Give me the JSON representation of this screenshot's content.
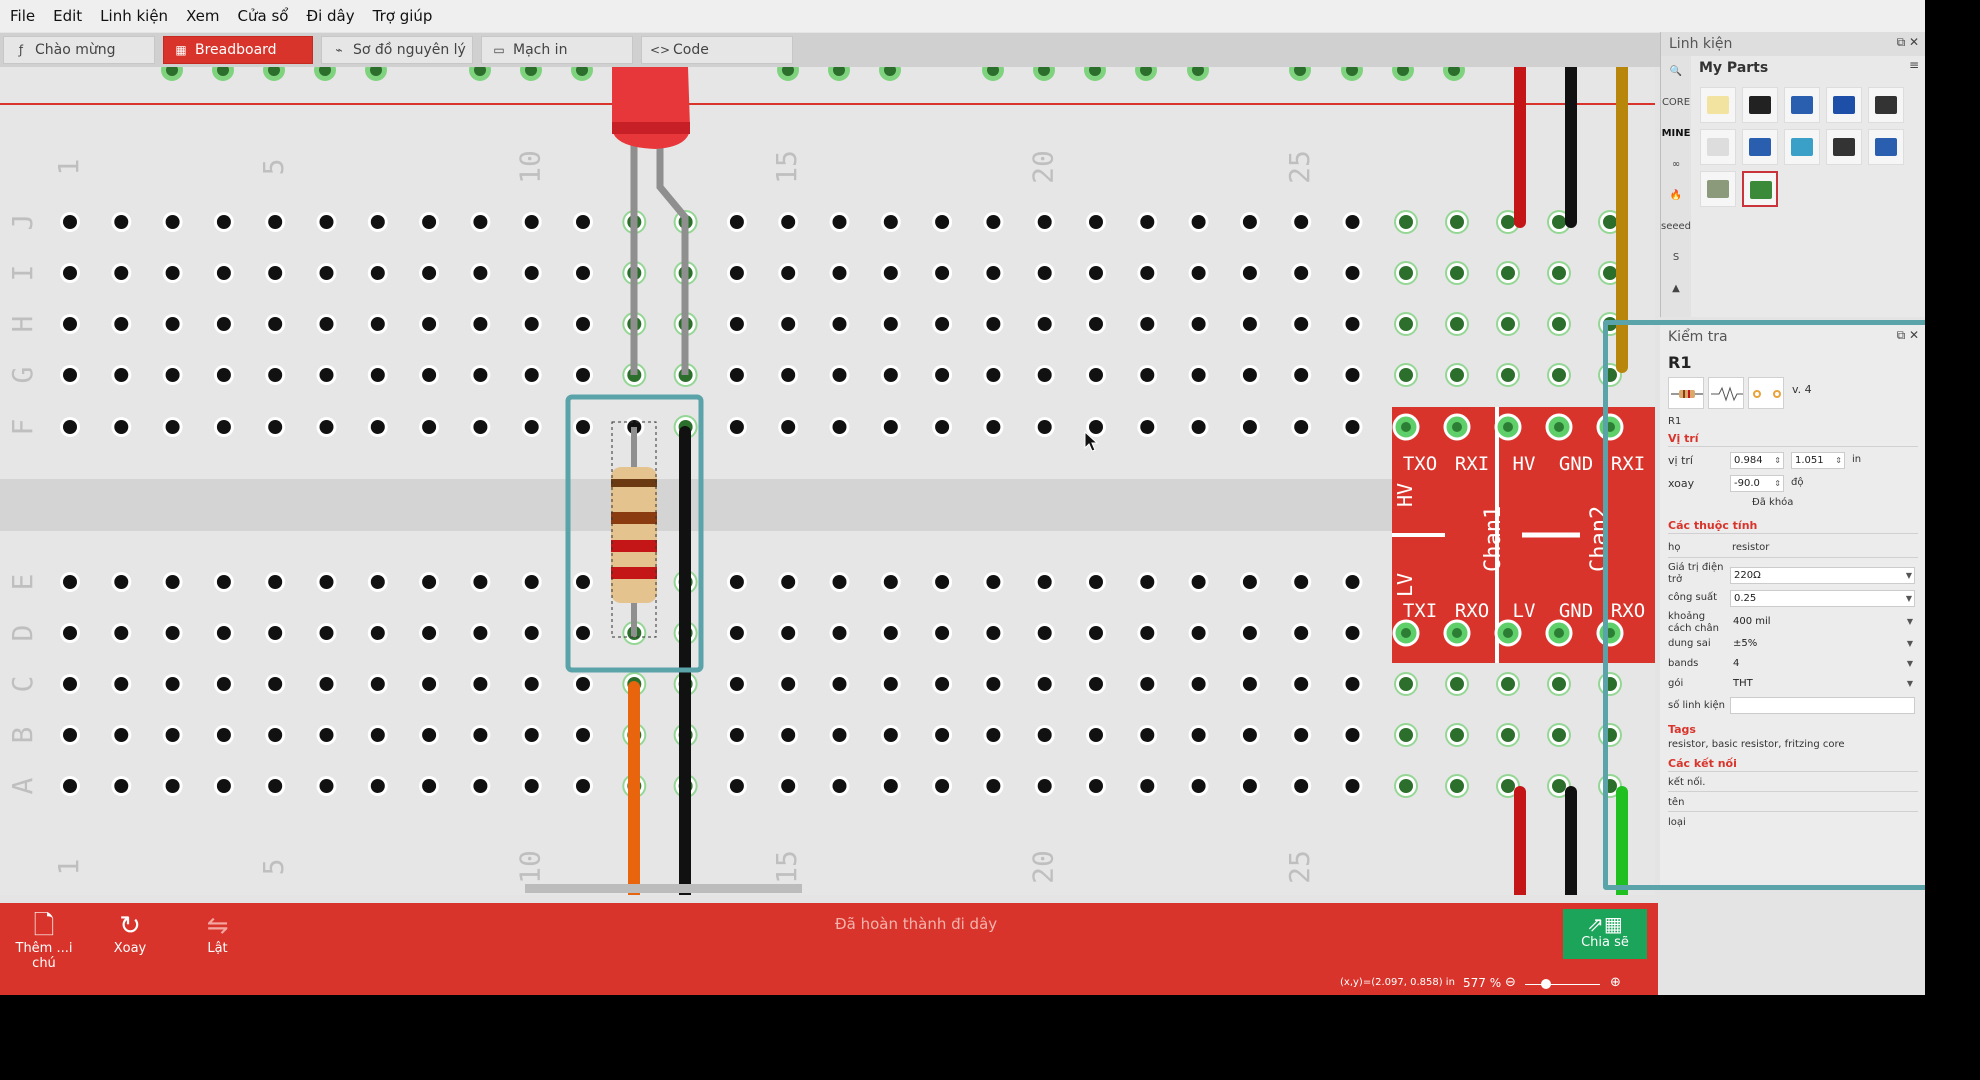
{
  "menu": {
    "items": [
      "File",
      "Edit",
      "Linh kiện",
      "Xem",
      "Cửa sổ",
      "Đi dây",
      "Trợ giúp"
    ]
  },
  "tabs": [
    {
      "label": "Chào mừng",
      "icon": "fritzing-icon",
      "active": false
    },
    {
      "label": "Breadboard",
      "icon": "breadboard-icon",
      "active": true
    },
    {
      "label": "Sơ đồ nguyên lý",
      "icon": "schematic-icon",
      "active": false
    },
    {
      "label": "Mạch in",
      "icon": "pcb-icon",
      "active": false
    },
    {
      "label": "Code",
      "icon": "code-icon",
      "active": false
    }
  ],
  "breadboard": {
    "column_labels_top": [
      "1",
      "5",
      "10",
      "15",
      "20",
      "25"
    ],
    "column_labels_bottom": [
      "1",
      "5",
      "10",
      "15",
      "20",
      "25"
    ],
    "row_labels_top": [
      "J",
      "I",
      "H",
      "G",
      "F"
    ],
    "row_labels_bottom": [
      "E",
      "D",
      "C",
      "B",
      "A"
    ],
    "level_shifter_labels": {
      "top_pins": [
        "TXO",
        "RXI",
        "HV",
        "GND",
        "RXI"
      ],
      "bottom_pins": [
        "TXI",
        "RXO",
        "LV",
        "GND",
        "RXO"
      ],
      "side_hv": "HV",
      "side_lv": "LV",
      "chan1": "Chan1",
      "chan2": "Chan2"
    }
  },
  "toolbar": {
    "add_note": "Thêm ...i chú",
    "rotate": "Xoay",
    "flip": "Lật",
    "status": "Đã hoàn thành đi dây",
    "share": "Chia sẽ"
  },
  "statusbar": {
    "coords": "(x,y)=(2.097, 0.858) in",
    "zoom": "577 %"
  },
  "parts_panel": {
    "title": "Linh kiện",
    "bin_title": "My Parts",
    "bins": [
      "CORE",
      "MINE",
      "arduino-icon",
      "sparkfun-icon",
      "seeed",
      "snootlab-icon"
    ]
  },
  "inspector": {
    "title": "Kiểm tra",
    "part_name": "R1",
    "version": "v. 4",
    "part_id": "R1",
    "placement_section": "Vị trí",
    "location_label": "vị trí",
    "location_x": "0.984",
    "location_y": "1.051",
    "location_unit": "in",
    "rotation_label": "xoay",
    "rotation_value": "-90.0",
    "rotation_unit": "độ",
    "locked_label": "Đã khóa",
    "properties_section": "Các thuộc tính",
    "family_label": "họ",
    "family_value": "resistor",
    "resistance_label": "Giá trị điện trở",
    "resistance_value": "220Ω",
    "power_label": "công suất",
    "power_value": "0.25",
    "pin_spacing_label": "khoảng cách chân",
    "pin_spacing_value": "400 mil",
    "tolerance_label": "dung sai",
    "tolerance_value": "±5%",
    "bands_label": "bands",
    "bands_value": "4",
    "package_label": "gói",
    "package_value": "THT",
    "part_number_label": "số linh kiện",
    "part_number_value": "",
    "tags_section": "Tags",
    "tags_value": "resistor, basic resistor, fritzing core",
    "connections_section": "Các kết nối",
    "conn_label": "kết nối.",
    "name_label": "tên",
    "type_label": "loại"
  },
  "colors": {
    "accent": "#d9342b",
    "connected_hole": "#7fd37f",
    "highlight": "#5aa3a8"
  }
}
